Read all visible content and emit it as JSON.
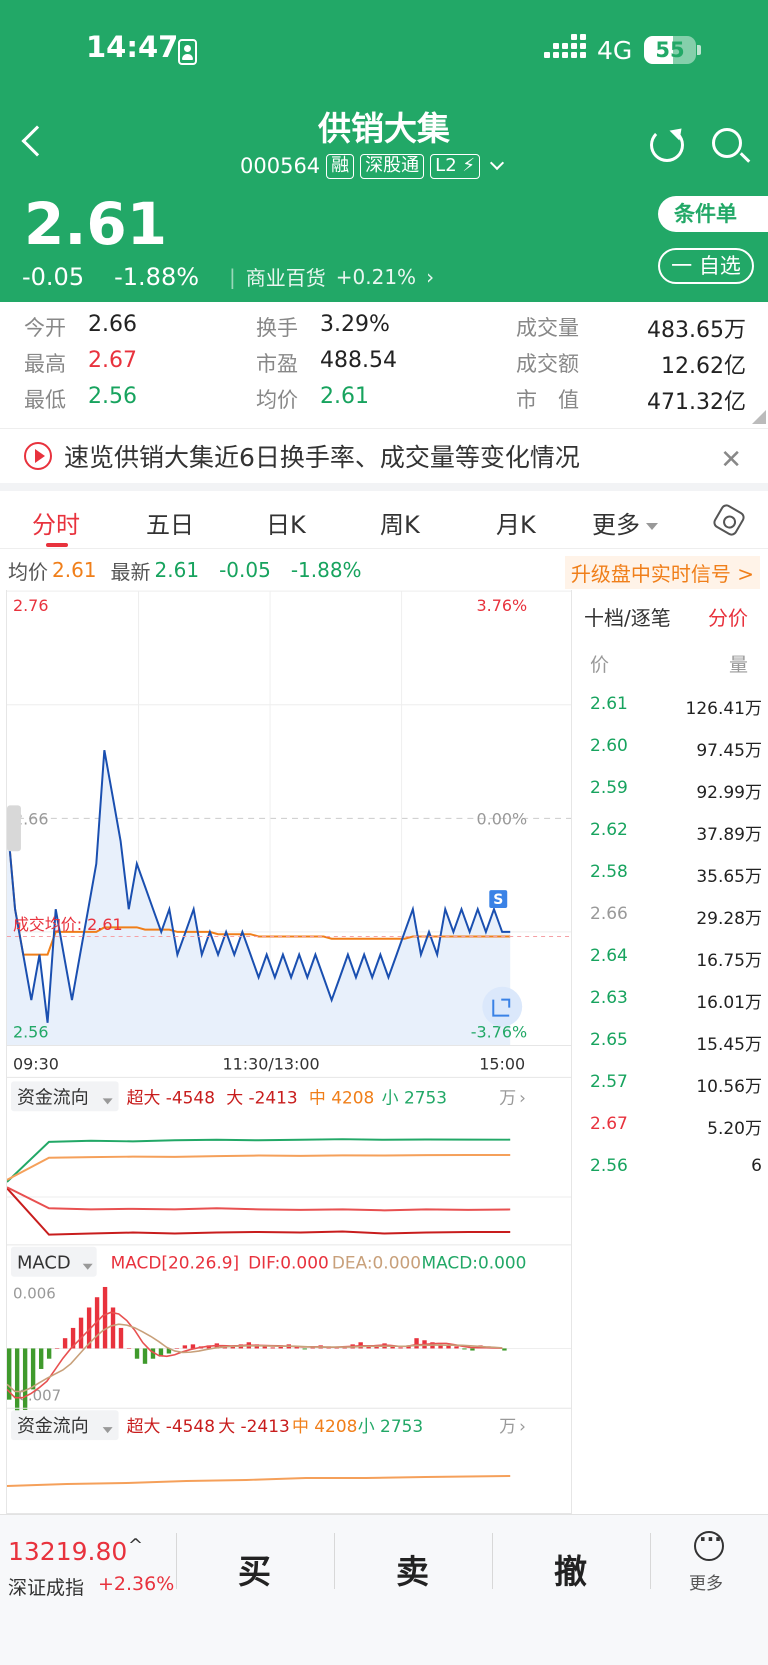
{
  "status": {
    "time": "14:47",
    "network": "4G",
    "battery": "55",
    "battery_level": 0.55
  },
  "header": {
    "name": "供销大集",
    "code": "000564",
    "tags": [
      "融",
      "深股通",
      "L2"
    ],
    "price": "2.61",
    "change": "-0.05",
    "change_pct": "-1.88%",
    "industry": "商业百货",
    "industry_pct": "+0.21%",
    "cond_order": "条件单",
    "watch": "一 自选"
  },
  "quote": {
    "open_label": "今开",
    "open": "2.66",
    "high_label": "最高",
    "high": "2.67",
    "low_label": "最低",
    "low": "2.56",
    "turnover_label": "换手",
    "turnover": "3.29%",
    "pe_label": "市盈",
    "pe": "488.54",
    "avg_label": "均价",
    "avg": "2.61",
    "vol_label": "成交量",
    "vol": "483.65万",
    "amt_label": "成交额",
    "amt": "12.62亿",
    "mcap_label": "市　值",
    "mcap": "471.32亿"
  },
  "banner": {
    "text": "速览供销大集近6日换手率、成交量等变化情况"
  },
  "tabs": [
    "分时",
    "五日",
    "日K",
    "周K",
    "月K",
    "更多"
  ],
  "info": {
    "avg_label": "均价",
    "avg": "2.61",
    "latest_label": "最新",
    "latest": "2.61",
    "chg": "-0.05",
    "pct": "-1.88%",
    "upgrade": "升级盘中实时信号 >"
  },
  "chart_data": [
    {
      "type": "line",
      "title": "分时",
      "y_left_ticks": [
        "2.76",
        "2.66",
        "2.56"
      ],
      "y_right_ticks": [
        "3.76%",
        "0.00%",
        "-3.76%"
      ],
      "x_ticks": [
        "09:30",
        "11:30/13:00",
        "15:00"
      ],
      "ylim": [
        2.56,
        2.76
      ],
      "avg_label": "成交均价: 2.61",
      "marker": "S",
      "series": [
        {
          "name": "价格",
          "values": [
            2.66,
            2.62,
            2.6,
            2.58,
            2.6,
            2.57,
            2.62,
            2.6,
            2.58,
            2.6,
            2.62,
            2.64,
            2.69,
            2.67,
            2.65,
            2.62,
            2.64,
            2.63,
            2.62,
            2.61,
            2.62,
            2.6,
            2.61,
            2.62,
            2.6,
            2.61,
            2.6,
            2.61,
            2.6,
            2.61,
            2.6,
            2.59,
            2.6,
            2.59,
            2.6,
            2.59,
            2.6,
            2.59,
            2.6,
            2.59,
            2.58,
            2.59,
            2.6,
            2.59,
            2.6,
            2.59,
            2.6,
            2.59,
            2.6,
            2.61,
            2.62,
            2.6,
            2.61,
            2.6,
            2.62,
            2.61,
            2.62,
            2.61,
            2.62,
            2.61,
            2.62,
            2.61,
            2.61
          ]
        },
        {
          "name": "均价",
          "values": [
            2.66,
            2.62,
            2.6,
            2.6,
            2.6,
            2.6,
            2.61,
            2.61,
            2.61,
            2.61,
            2.61,
            2.61,
            2.612,
            2.612,
            2.612,
            2.612,
            2.612,
            2.611,
            2.611,
            2.611,
            2.611,
            2.61,
            2.61,
            2.61,
            2.61,
            2.61,
            2.609,
            2.609,
            2.609,
            2.609,
            2.609,
            2.608,
            2.608,
            2.608,
            2.608,
            2.608,
            2.608,
            2.608,
            2.608,
            2.608,
            2.607,
            2.607,
            2.607,
            2.607,
            2.607,
            2.607,
            2.607,
            2.607,
            2.607,
            2.607,
            2.608,
            2.608,
            2.608,
            2.608,
            2.608,
            2.608,
            2.608,
            2.608,
            2.608,
            2.608,
            2.608,
            2.608,
            2.608
          ]
        }
      ]
    },
    {
      "type": "line",
      "title": "资金流向",
      "legend": [
        {
          "name": "超大",
          "value": "-4548"
        },
        {
          "name": "大",
          "value": "-2413"
        },
        {
          "name": "中",
          "value": "4208"
        },
        {
          "name": "小",
          "value": "2753"
        }
      ],
      "unit": "万",
      "series": [
        {
          "name": "超大",
          "values": [
            -400,
            -4800,
            -4700,
            -4600,
            -4700,
            -4600,
            -4550,
            -4600,
            -4500,
            -4700,
            -4600,
            -4550,
            -4548
          ]
        },
        {
          "name": "大",
          "values": [
            -300,
            -2300,
            -2400,
            -2350,
            -2400,
            -2300,
            -2400,
            -2450,
            -2400,
            -2500,
            -2400,
            -2450,
            -2413
          ]
        },
        {
          "name": "中",
          "values": [
            200,
            4000,
            4100,
            4050,
            4150,
            4200,
            4150,
            4200,
            4250,
            4200,
            4230,
            4220,
            4208
          ]
        },
        {
          "name": "小",
          "values": [
            400,
            2500,
            2550,
            2600,
            2580,
            2650,
            2700,
            2680,
            2720,
            2700,
            2740,
            2750,
            2753
          ]
        }
      ]
    },
    {
      "type": "bar",
      "title": "MACD",
      "params": "MACD[20.26.9]",
      "dif": "DIF:0.000",
      "dea": "DEA:0.000",
      "macd": "MACD:0.000",
      "y_ticks": [
        "0.006",
        "-0.007"
      ],
      "values": [
        -0.005,
        -0.007,
        -0.006,
        -0.004,
        -0.002,
        -0.001,
        0,
        0.001,
        0.002,
        0.003,
        0.004,
        0.005,
        0.006,
        0.004,
        0.002,
        0,
        -0.001,
        -0.0015,
        -0.001,
        -0.0008,
        -0.0005,
        0,
        0.0003,
        0.0004,
        0.0002,
        0.0003,
        0.0005,
        0.0003,
        0.0002,
        0.0004,
        0.0006,
        0.0004,
        0.0002,
        0.0001,
        0.0003,
        0.0004,
        0.0002,
        -0.0001,
        0.0002,
        0.0003,
        0.0002,
        0.0001,
        0.0002,
        0.0004,
        0.0006,
        0.0003,
        0.0002,
        0.0005,
        0.0002,
        0.0001,
        0.0003,
        0.001,
        0.0008,
        0.0006,
        0.0004,
        0.0003,
        0.0002,
        -0.0001,
        -0.0002,
        0.0003,
        0.0002,
        0.0001,
        -0.0002
      ]
    }
  ],
  "flow2": {
    "title": "资金流向",
    "xl": "超大",
    "xl_v": "-4548",
    "l": "大",
    "l_v": "-2413",
    "m": "中",
    "m_v": "4208",
    "s": "小",
    "s_v": "2753",
    "unit": "万"
  },
  "orderbook": {
    "tabs": [
      "十档/逐笔",
      "分价"
    ],
    "price_label": "价",
    "vol_label": "量",
    "rows": [
      {
        "p": "2.61",
        "v": "126.41万",
        "c": "down"
      },
      {
        "p": "2.60",
        "v": "97.45万",
        "c": "down"
      },
      {
        "p": "2.59",
        "v": "92.99万",
        "c": "down"
      },
      {
        "p": "2.62",
        "v": "37.89万",
        "c": "down"
      },
      {
        "p": "2.58",
        "v": "35.65万",
        "c": "down"
      },
      {
        "p": "2.66",
        "v": "29.28万",
        "c": "gray"
      },
      {
        "p": "2.64",
        "v": "16.75万",
        "c": "down"
      },
      {
        "p": "2.63",
        "v": "16.01万",
        "c": "down"
      },
      {
        "p": "2.65",
        "v": "15.45万",
        "c": "down"
      },
      {
        "p": "2.57",
        "v": "10.56万",
        "c": "down"
      },
      {
        "p": "2.67",
        "v": "5.20万",
        "c": "up"
      },
      {
        "p": "2.56",
        "v": "6",
        "c": "down"
      }
    ]
  },
  "bottom": {
    "index_value": "13219.80",
    "index_name": "深证成指",
    "index_pct": "+2.36%",
    "buy": "买",
    "sell": "卖",
    "cancel": "撤",
    "more": "更多"
  },
  "colors": {
    "green": "#22a867",
    "red": "#e8323d",
    "orange": "#f07f1a",
    "blue": "#1a4fb0"
  }
}
